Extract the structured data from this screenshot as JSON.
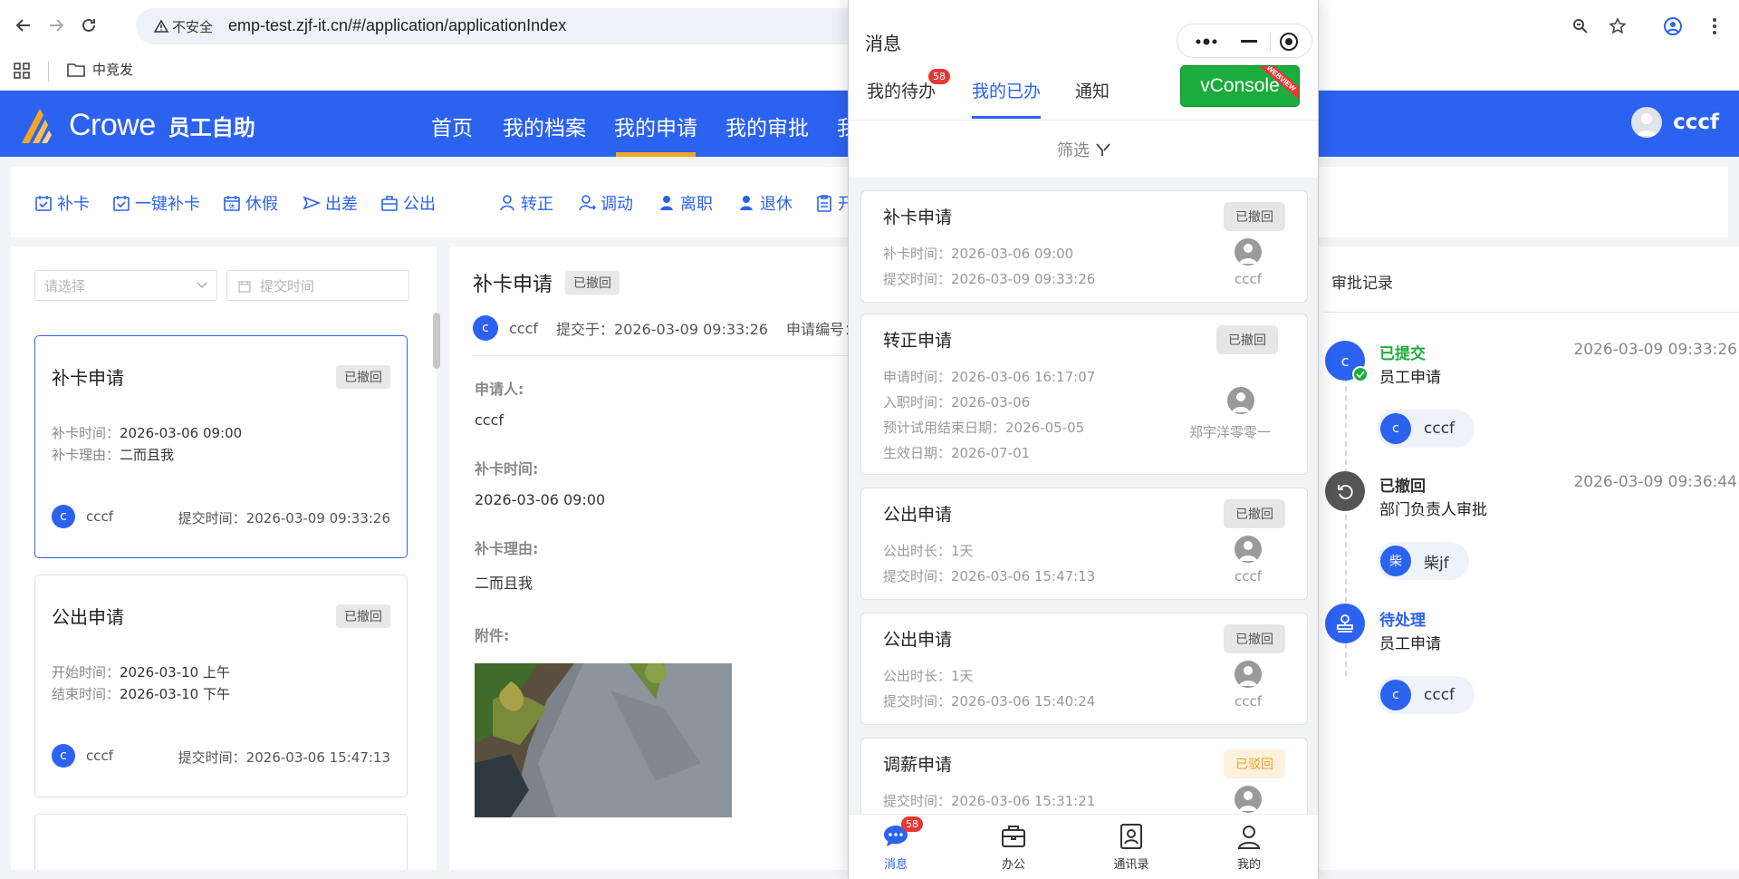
{
  "browser": {
    "security_label": "不安全",
    "url": "emp-test.zjf-it.cn/#/application/applicationIndex",
    "bookmark_folder": "中竞发"
  },
  "header": {
    "brand": "Crowe",
    "subtitle": "员工自助",
    "nav": [
      "首页",
      "我的档案",
      "我的申请",
      "我的审批",
      "我"
    ],
    "active_nav": "我的申请",
    "user": "cccf",
    "accent": "#2c62f0",
    "underline_color": "#f5a623"
  },
  "quickbar": [
    "补卡",
    "一键补卡",
    "休假",
    "出差",
    "公出",
    "转正",
    "调动",
    "离职",
    "退休",
    "开"
  ],
  "filters": {
    "select_placeholder": "请选择",
    "date_placeholder": "提交时间"
  },
  "cards": [
    {
      "title": "补卡申请",
      "status": "已撤回",
      "line1_label": "补卡时间：",
      "line1_value": "2026-03-06 09:00",
      "line2_label": "补卡理由：",
      "line2_value": "二而且我",
      "avatar": "c",
      "user": "cccf",
      "submit_label": "提交时间：",
      "submit_time": "2026-03-09 09:33:26"
    },
    {
      "title": "公出申请",
      "status": "已撤回",
      "line1_label": "开始时间：",
      "line1_value": "2026-03-10 上午",
      "line2_label": "结束时间：",
      "line2_value": "2026-03-10 下午",
      "avatar": "c",
      "user": "cccf",
      "submit_label": "提交时间：",
      "submit_time": "2026-03-06 15:47:13"
    }
  ],
  "detail": {
    "title": "补卡申请",
    "status": "已撤回",
    "avatar": "c",
    "user": "cccf",
    "submitted": "提交于：2026-03-09 09:33:26",
    "app_no": "申请编号：中",
    "applicant_label": "申请人:",
    "applicant": "cccf",
    "time_label": "补卡时间:",
    "time": "2026-03-06 09:00",
    "reason_label": "补卡理由:",
    "reason": "二而且我",
    "attachment_label": "附件:"
  },
  "approval": {
    "title": "审批记录",
    "steps": [
      {
        "status": "已提交",
        "color": "#1aad3d",
        "node": "员工申请",
        "time": "2026-03-09 09:33:26",
        "avatar": "c",
        "person": "cccf"
      },
      {
        "status": "已撤回",
        "color": "#333333",
        "node": "部门负责人审批",
        "time": "2026-03-09 09:36:44",
        "avatar": "柴",
        "person": "柴jf"
      },
      {
        "status": "待处理",
        "color": "#2c62f0",
        "node": "员工申请",
        "time": "",
        "avatar": "c",
        "person": "cccf"
      }
    ]
  },
  "phone": {
    "title": "消息",
    "tabs": [
      "我的待办",
      "我的已办",
      "通知"
    ],
    "active_tab": "我的已办",
    "todo_badge": "58",
    "vconsole": "vConsole",
    "ribbon": "WEBVIEW",
    "filter": "筛选",
    "items": [
      {
        "title": "补卡申请",
        "status": "已撤回",
        "lines": [
          "补卡时间：2026-03-06 09:00",
          "提交时间：2026-03-09 09:33:26"
        ],
        "person": "cccf"
      },
      {
        "title": "转正申请",
        "status": "已撤回",
        "lines": [
          "申请时间：2026-03-06 16:17:07",
          "入职时间：2026-03-06",
          "预计试用结束日期：2026-05-05",
          "生效日期：2026-07-01"
        ],
        "person": "郑宇洋零零一"
      },
      {
        "title": "公出申请",
        "status": "已撤回",
        "lines": [
          "公出时长：1天",
          "提交时间：2026-03-06 15:47:13"
        ],
        "person": "cccf"
      },
      {
        "title": "公出申请",
        "status": "已撤回",
        "lines": [
          "公出时长：1天",
          "提交时间：2026-03-06 15:40:24"
        ],
        "person": "cccf"
      },
      {
        "title": "调薪申请",
        "status": "已驳回",
        "lines": [
          "提交时间：2026-03-06 15:31:21"
        ],
        "person": ""
      }
    ],
    "tabbar": [
      "消息",
      "办公",
      "通讯录",
      "我的"
    ],
    "msg_badge": "58"
  }
}
